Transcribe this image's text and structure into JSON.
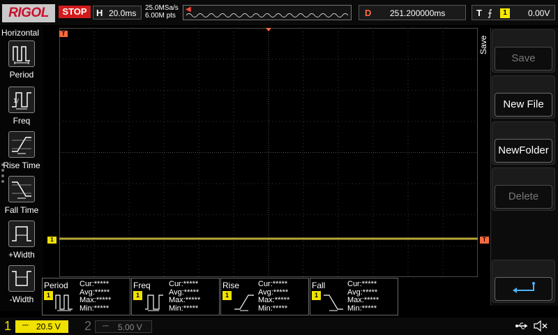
{
  "brand": "RIGOL",
  "run_state": "STOP",
  "horizontal": {
    "label": "H",
    "scale": "20.0ms"
  },
  "acquisition": {
    "sample_rate": "25.0MSa/s",
    "memory_depth": "6.00M pts"
  },
  "delay": {
    "label": "D",
    "value": "251.200000ms"
  },
  "trigger": {
    "label": "T",
    "edge_glyph": "⨍",
    "source": "1",
    "level": "0.00V"
  },
  "left_menu": {
    "title": "Horizontal",
    "items": [
      {
        "label": "Period",
        "icon": "period-icon"
      },
      {
        "label": "Freq",
        "icon": "freq-icon"
      },
      {
        "label": "Rise Time",
        "icon": "rise-time-icon"
      },
      {
        "label": "Fall Time",
        "icon": "fall-time-icon"
      },
      {
        "label": "+Width",
        "icon": "positive-width-icon"
      },
      {
        "label": "-Width",
        "icon": "negative-width-icon"
      }
    ]
  },
  "right_menu": {
    "title": "Save",
    "keys": [
      {
        "label": "Save",
        "enabled": false
      },
      {
        "label": "New File",
        "enabled": true
      },
      {
        "label": "NewFolder",
        "enabled": true
      },
      {
        "label": "Delete",
        "enabled": false
      },
      {
        "label": "",
        "icon": "return-arrow-icon",
        "enabled": true
      }
    ]
  },
  "markers": {
    "trigger_position": "T",
    "channel1": "1",
    "trigger_level": "T"
  },
  "measurements": [
    {
      "name": "Period",
      "channel": "1",
      "cur": "Cur:*****",
      "avg": "Avg:*****",
      "max": "Max:*****",
      "min": "Min:*****"
    },
    {
      "name": "Freq",
      "channel": "1",
      "cur": "Cur:*****",
      "avg": "Avg:*****",
      "max": "Max:*****",
      "min": "Min:*****"
    },
    {
      "name": "Rise",
      "channel": "1",
      "cur": "Cur:*****",
      "avg": "Avg:*****",
      "max": "Max:*****",
      "min": "Min:*****"
    },
    {
      "name": "Fall",
      "channel": "1",
      "cur": "Cur:*****",
      "avg": "Avg:*****",
      "max": "Max:*****",
      "min": "Min:*****"
    }
  ],
  "channels": [
    {
      "number": "1",
      "coupling": "⎓",
      "scale": "20.5 V",
      "active": true
    },
    {
      "number": "2",
      "coupling": "⎓",
      "scale": "5.00 V",
      "active": false
    }
  ],
  "colors": {
    "ch1": "#f0e100",
    "trigger": "#ff6a3d",
    "stop": "#d21c1c",
    "grid": "#3a3a3a"
  }
}
